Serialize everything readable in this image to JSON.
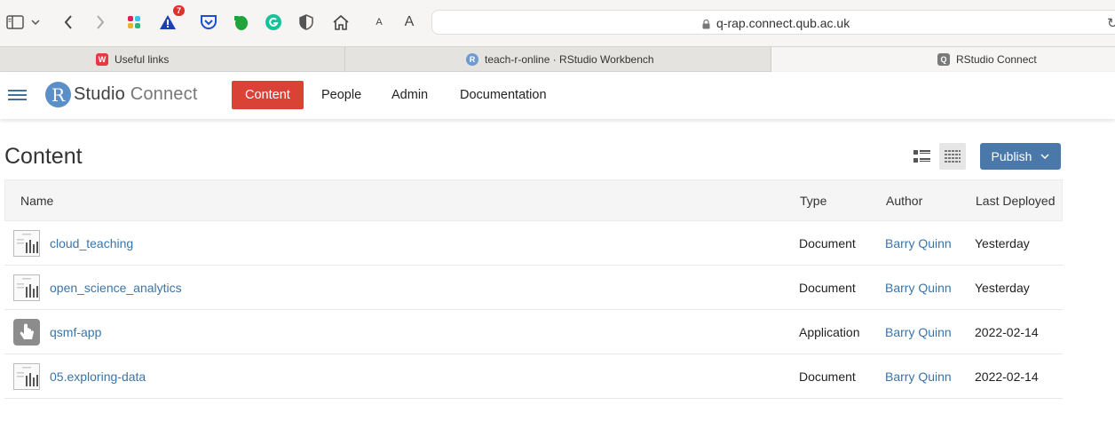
{
  "browser": {
    "address": "q-rap.connect.qub.ac.uk",
    "extension_badge": "7",
    "text_size_small": "A",
    "text_size_large": "A",
    "tabs": [
      {
        "label": "Useful links",
        "favicon": "W",
        "color": "#e63946"
      },
      {
        "label": "teach-r-online · RStudio Workbench",
        "favicon": "R",
        "color": "#6d9bd0"
      },
      {
        "label": "RStudio Connect",
        "favicon": "Q",
        "color": "#7a7a7a"
      }
    ]
  },
  "app": {
    "logo_r": "R",
    "logo_studio": "Studio",
    "logo_connect": "Connect",
    "nav": [
      "Content",
      "People",
      "Admin",
      "Documentation"
    ],
    "accent": "#d94234"
  },
  "content": {
    "title": "Content",
    "publish_label": "Publish",
    "columns": [
      "Name",
      "Type",
      "Author",
      "Last Deployed"
    ],
    "rows": [
      {
        "name": "cloud_teaching",
        "type": "Document",
        "author": "Barry Quinn",
        "deployed": "Yesterday",
        "icon": "document-icon"
      },
      {
        "name": "open_science_analytics",
        "type": "Document",
        "author": "Barry Quinn",
        "deployed": "Yesterday",
        "icon": "document-icon"
      },
      {
        "name": "qsmf-app",
        "type": "Application",
        "author": "Barry Quinn",
        "deployed": "2022-02-14",
        "icon": "application-icon"
      },
      {
        "name": "05.exploring-data",
        "type": "Document",
        "author": "Barry Quinn",
        "deployed": "2022-02-14",
        "icon": "document-icon"
      }
    ]
  }
}
